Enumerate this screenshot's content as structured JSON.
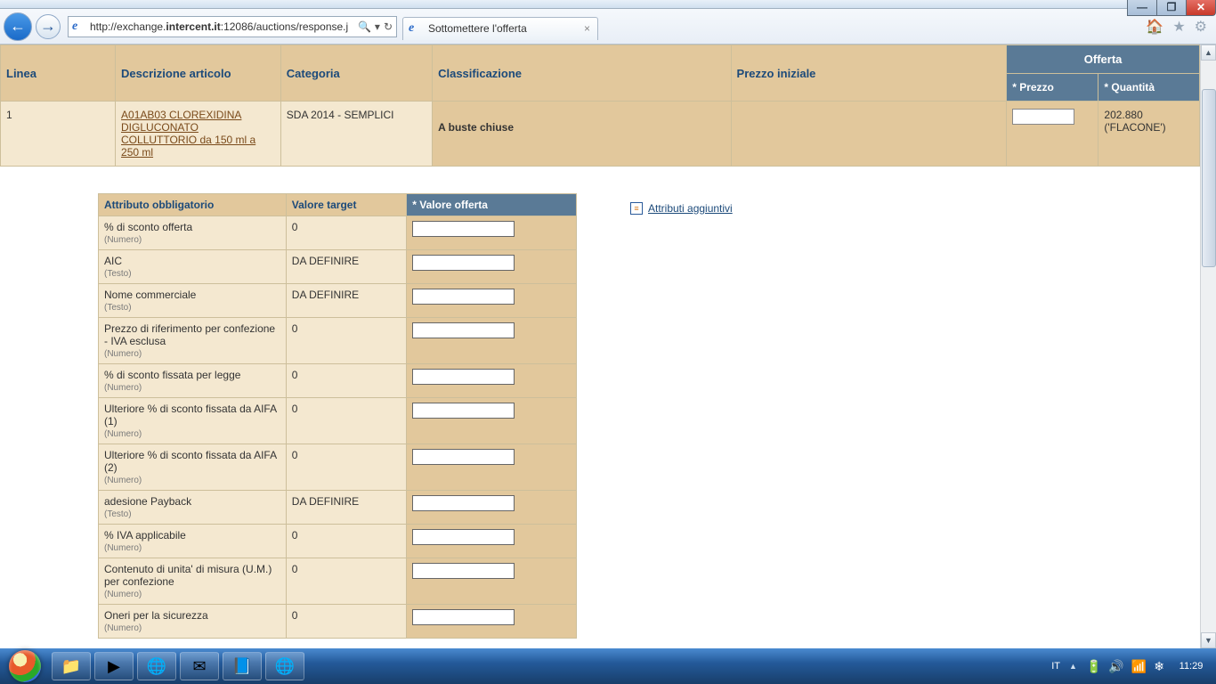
{
  "window": {
    "min": "—",
    "max": "❐",
    "close": "✕"
  },
  "browser": {
    "url_plain_before": "http://exchange.",
    "url_bold": "intercent.it",
    "url_plain_after": ":12086/auctions/response.j",
    "search_icon": "🔍",
    "dropdown": "▾",
    "refresh": "↻",
    "tab_title": "Sottomettere l'offerta",
    "home": "🏠",
    "star": "★",
    "gear": "⚙"
  },
  "main_table": {
    "headers": {
      "linea": "Linea",
      "descrizione": "Descrizione articolo",
      "categoria": "Categoria",
      "classificazione": "Classificazione",
      "prezzo_iniziale": "Prezzo iniziale",
      "offerta": "Offerta",
      "prezzo": "* Prezzo",
      "quantita": "* Quantità"
    },
    "row": {
      "linea": "1",
      "descrizione": "A01AB03 CLOREXIDINA DIGLUCONATO COLLUTTORIO da 150 ml a 250 ml",
      "categoria": "SDA 2014 - SEMPLICI",
      "classificazione": "A buste chiuse",
      "prezzo_iniziale": "",
      "quantita": "202.880 ('FLACONE')"
    }
  },
  "attrs": {
    "headers": {
      "name": "Attributo obbligatorio",
      "target": "Valore target",
      "offerta": "*  Valore offerta"
    },
    "type_numero": "(Numero)",
    "type_testo": "(Testo)",
    "rows": [
      {
        "name": "% di sconto offerta",
        "type": "numero",
        "target": "0"
      },
      {
        "name": "AIC",
        "type": "testo",
        "target": "DA DEFINIRE"
      },
      {
        "name": "Nome commerciale",
        "type": "testo",
        "target": "DA DEFINIRE"
      },
      {
        "name": "Prezzo di riferimento per confezione - IVA esclusa",
        "type": "numero",
        "target": "0"
      },
      {
        "name": "% di sconto fissata per legge",
        "type": "numero",
        "target": "0"
      },
      {
        "name": "Ulteriore % di sconto fissata da AIFA (1)",
        "type": "numero",
        "target": "0"
      },
      {
        "name": "Ulteriore % di sconto fissata da AIFA (2)",
        "type": "numero",
        "target": "0"
      },
      {
        "name": "adesione Payback",
        "type": "testo",
        "target": "DA DEFINIRE"
      },
      {
        "name": "% IVA applicabile",
        "type": "numero",
        "target": "0"
      },
      {
        "name": "Contenuto di unita' di misura (U.M.) per confezione",
        "type": "numero",
        "target": "0"
      },
      {
        "name": "Oneri per la sicurezza",
        "type": "numero",
        "target": "0"
      }
    ]
  },
  "add_attrs_link": "Attributi aggiuntivi",
  "taskbar": {
    "items": [
      "📁",
      "▶",
      "🌐",
      "✉",
      "📘",
      "🌐"
    ],
    "lang": "IT",
    "clock": "11:29"
  }
}
